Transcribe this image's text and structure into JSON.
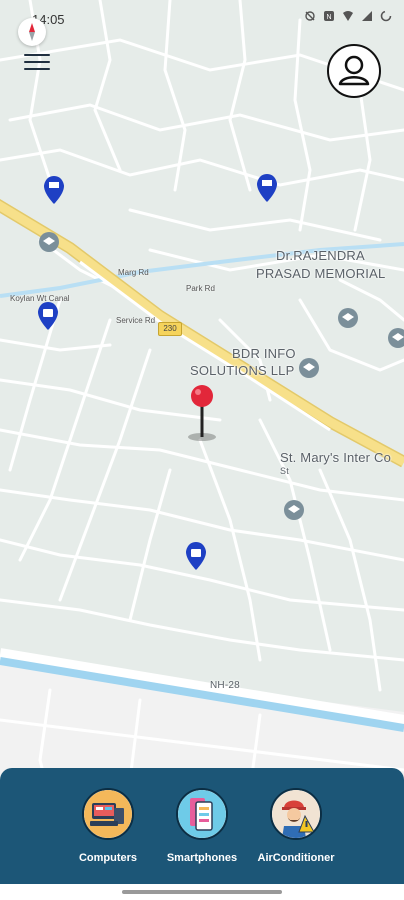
{
  "status_bar": {
    "time": "14:05"
  },
  "map": {
    "labels": {
      "rajendra_line1": "Dr.RAJENDRA",
      "rajendra_line2": "PRASAD MEMORIAL",
      "bdr_line1": "BDR INFO",
      "bdr_line2": "SOLUTIONS LLP",
      "stmary_line1": "St. Mary's Inter Co",
      "stmary_line2": "St",
      "nh28": "NH-28",
      "route_shield": "230",
      "park_rd": "Park Rd",
      "service_rd": "Service Rd",
      "marg": "Marg Rd",
      "canal": "Koylan Wt Canal"
    },
    "icons": {
      "pois": [
        "atm-pin",
        "atm-pin",
        "school-pin",
        "school-pin",
        "school-pin",
        "school-pin",
        "shopping-pin",
        "shopping-pin"
      ],
      "location_pin": "location-pin-red"
    },
    "colors": {
      "highway": "#f7e08a",
      "road": "#ffffff",
      "land": "#e6ece9",
      "water": "#9fd4f0",
      "pin_red": "#e2273a",
      "poi_blue": "#1e40c4",
      "poi_gray": "#7b8f9a"
    }
  },
  "header": {
    "menu_icon": "menu-icon",
    "profile_icon": "profile-icon"
  },
  "categories": [
    {
      "label": "Computers",
      "icon": "computer-icon"
    },
    {
      "label": "Smartphones",
      "icon": "smartphone-icon"
    },
    {
      "label": "AirConditioner",
      "icon": "repairman-icon"
    }
  ],
  "panel_color": "#1c5677"
}
